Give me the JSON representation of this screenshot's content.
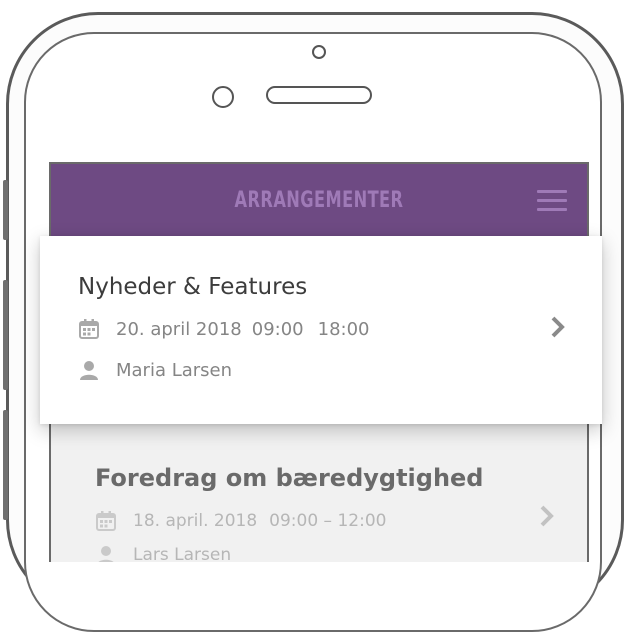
{
  "header": {
    "title": "ARRANGEMENTER",
    "menu_icon": "hamburger-menu-icon",
    "background": "#6e4a83",
    "title_color": "#9f7ab7"
  },
  "events": [
    {
      "title": "Nyheder & Features",
      "date": "20. april 2018",
      "start": "09:00",
      "end": "18:00",
      "person": "Maria Larsen"
    },
    {
      "title": "Foredrag om bæredygtighed",
      "date": "18. april. 2018",
      "time": "09:00 – 12:00",
      "person": "Lars Larsen"
    }
  ],
  "icons": {
    "calendar": "calendar-icon",
    "person": "person-icon",
    "chevron": "chevron-right-icon"
  }
}
